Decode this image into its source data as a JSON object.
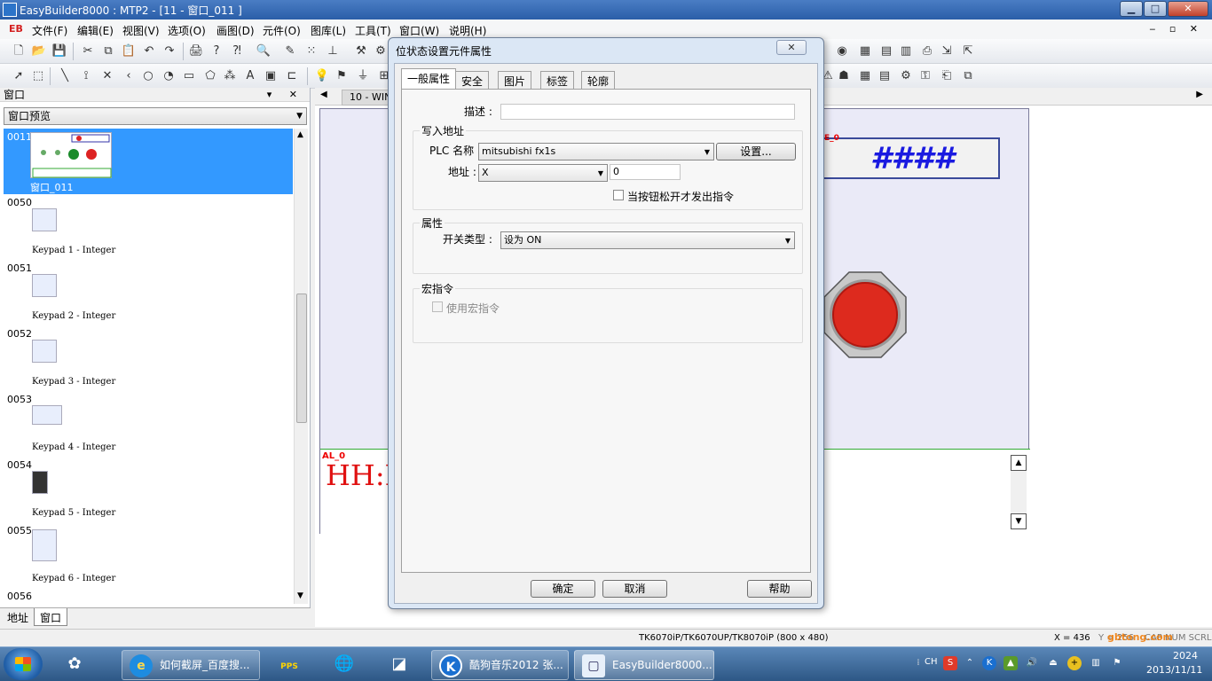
{
  "window": {
    "title": "EasyBuilder8000 : MTP2 - [11 - 窗口_011 ]",
    "min_label": "▁",
    "max_label": "□",
    "close_label": "✕"
  },
  "menubar": {
    "logo": "EB",
    "items": [
      "文件(F)",
      "编辑(E)",
      "视图(V)",
      "选项(O)",
      "画图(D)",
      "元件(O)",
      "图库(L)",
      "工具(T)",
      "窗口(W)",
      "说明(H)"
    ],
    "mdi_controls": "‒ ▫ ✕"
  },
  "left_panel": {
    "title": "窗口",
    "header_controls": "▾ ✕",
    "preview_select": "窗口预览",
    "windows": [
      {
        "num": "0011",
        "label": "窗口_011",
        "selected": true
      },
      {
        "num": "0050",
        "label": "Keypad 1 - Integer"
      },
      {
        "num": "0051",
        "label": "Keypad 2 - Integer"
      },
      {
        "num": "0052",
        "label": "Keypad 3 - Integer"
      },
      {
        "num": "0053",
        "label": "Keypad 4 - Integer"
      },
      {
        "num": "0054",
        "label": "Keypad 5 - Integer"
      },
      {
        "num": "0055",
        "label": "Keypad 6 - Integer"
      },
      {
        "num": "0056",
        "label": ""
      }
    ],
    "tabs": [
      "地址",
      "窗口"
    ]
  },
  "editor": {
    "tab_label": "10 - WIN",
    "numeric_tag": "E_0",
    "numeric_value": "####",
    "alarm_tag": "AL_0",
    "alarm_time": "HH:M"
  },
  "statusbar": {
    "model": "TK6070iP/TK6070UP/TK8070iP (800 x 480)",
    "x": "X = 436",
    "y": "Y = 256",
    "caps": "CAP NUM SCRL"
  },
  "dialog": {
    "title": "位状态设置元件属性",
    "close_label": "✕",
    "tabs": [
      "一般属性",
      "安全",
      "图片",
      "标签",
      "轮廓"
    ],
    "description_label": "描述 :",
    "description_value": "",
    "write_address_group": "写入地址",
    "plc_name_label": "PLC 名称 :",
    "plc_name_value": "mitsubishi fx1s",
    "settings_button": "设置...",
    "address_label": "地址 :",
    "address_device": "X",
    "address_value": "0",
    "release_checkbox_label": "当按钮松开才发出指令",
    "attribute_group": "属性",
    "switch_type_label": "开关类型 :",
    "switch_type_value": "设为 ON",
    "macro_group": "宏指令",
    "use_macro_label": "使用宏指令",
    "ok_button": "确定",
    "cancel_button": "取消",
    "help_button": "帮助"
  },
  "taskbar": {
    "tasks": [
      {
        "label": "如何截屏_百度搜..."
      },
      {
        "label": "酷狗音乐2012 张..."
      },
      {
        "label": "EasyBuilder8000..."
      }
    ],
    "pinned_pps": "PPS",
    "lang": "CH",
    "clock_time": "2024",
    "clock_date": "2013/11/11"
  },
  "watermark": "gbtong.com"
}
